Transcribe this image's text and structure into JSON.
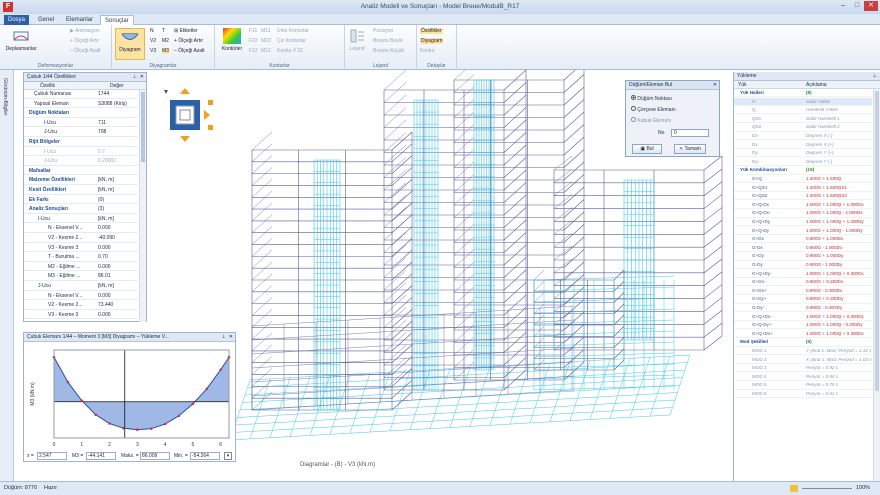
{
  "window": {
    "title": "Analiz Modeli ve Sonuçları - Model Breue/ModulB_R17",
    "app_icon": "F"
  },
  "tabs": [
    {
      "label": "Dosya"
    },
    {
      "label": "Genel"
    },
    {
      "label": "Elemanlar"
    },
    {
      "label": "Sonuçlar"
    }
  ],
  "ribbon": {
    "groups": [
      "Deformasyonlar",
      "Diyagramlar",
      "Konturlar",
      "Lejand",
      "Detaylar"
    ],
    "deform": {
      "big": "Deplasmanlar",
      "animate": "Animasyon",
      "inc": "Ölçeği Artır",
      "dec": "Ölçeği Azalt"
    },
    "diag": {
      "big": "Diyagram",
      "labels": "Etiketler",
      "inc": "Ölçeği Artır",
      "dec": "Ölçeği Azalt",
      "n": "N",
      "t": "T",
      "v2": "V2",
      "v3": "V3",
      "m2": "M2",
      "m3": "M3"
    },
    "contour": {
      "big": "Kontürler",
      "f11": "F11",
      "f22": "F22",
      "f12": "F12",
      "m11": "M11",
      "m22": "M22",
      "m12": "M12",
      "stress": "Ünlü Konturlar",
      "dual": "Çiz Konturlar",
      "contours": "Kontur #",
      "count": "32"
    },
    "legend": {
      "big": "Lejand",
      "pos": "Pozisyon",
      "inc": "Boyutu Büyüt",
      "dec": "Boyutu Küçült"
    },
    "detail": {
      "props": "Özellikler",
      "diagram": "Diyagram",
      "contour": "Kontur"
    }
  },
  "left_strip": "Görünüm-Bilgiler",
  "element_panel": {
    "title": "Çubuk 1/44 Özellikleri",
    "col_prop": "Özellik",
    "col_val": "Değer",
    "rows": [
      {
        "k": "Çubuk Numarası",
        "v": "1744",
        "t": "item"
      },
      {
        "k": "Yapısal Eleman",
        "v": "S3088 (Kiriş)",
        "t": "item"
      },
      {
        "k": "Düğüm Noktaları",
        "v": "",
        "t": "sec"
      },
      {
        "k": "I-Ucu",
        "v": "711",
        "t": "sub"
      },
      {
        "k": "J-Ucu",
        "v": "708",
        "t": "sub"
      },
      {
        "k": "Rijit Bölgeler",
        "v": "",
        "t": "sec"
      },
      {
        "k": "I-Ucu",
        "v": "0.7",
        "t": "gray"
      },
      {
        "k": "J-Ucu",
        "v": "0.20002",
        "t": "gray"
      },
      {
        "k": "Mafsallar",
        "v": "",
        "t": "sec"
      },
      {
        "k": "Malzeme Özellikleri",
        "v": "[kN, m]",
        "t": "sec"
      },
      {
        "k": "Kesit Özellikleri",
        "v": "[kN, m]",
        "t": "sec"
      },
      {
        "k": "Ek Farkı",
        "v": "(0)",
        "t": "sec"
      },
      {
        "k": "Analiz Sonuçları",
        "v": "(3)",
        "t": "sec"
      },
      {
        "k": "I-Ucu",
        "v": "[kN, m]",
        "t": "sub2"
      },
      {
        "k": "N - Eksenel V...",
        "v": "0.000",
        "t": "sub3"
      },
      {
        "k": "V2 - Kesme 2...",
        "v": "-40.090",
        "t": "sub3"
      },
      {
        "k": "V3 - Kesme 3",
        "v": "0.000",
        "t": "sub3"
      },
      {
        "k": "T - Burulma ...",
        "v": "0.70",
        "t": "sub3"
      },
      {
        "k": "M2 - Eğilme ...",
        "v": "0.000",
        "t": "sub3"
      },
      {
        "k": "M3 - Eğilme ...",
        "v": "86.01",
        "t": "sub3"
      },
      {
        "k": "J-Ucu",
        "v": "[kN, m]",
        "t": "sub2"
      },
      {
        "k": "N - Eksenel V...",
        "v": "0.000",
        "t": "sub3"
      },
      {
        "k": "V2 - Kesme 2...",
        "v": "73.440",
        "t": "sub3"
      },
      {
        "k": "V3 - Kesme 3",
        "v": "0.000",
        "t": "sub3"
      }
    ]
  },
  "graph_panel": {
    "title": "Çubuk Elemanı 1/44 – Moment 3 [M3] Diyagramı – Yükleme V...",
    "ylabel": "M3 (kN.m)",
    "x_label": "x =",
    "x_val": "2.547",
    "m3_label": "M3 =",
    "m3_val": "-44.141",
    "max_label": "Maks. =",
    "max_val": "86.009",
    "min_label": "Min. =",
    "min_val": "-54.264",
    "ticks": [
      "0",
      "1",
      "2",
      "3",
      "4",
      "5",
      "6"
    ],
    "curve": [
      [
        0,
        86
      ],
      [
        0.5,
        38
      ],
      [
        1,
        2
      ],
      [
        1.5,
        -25
      ],
      [
        2,
        -42
      ],
      [
        2.5,
        -51
      ],
      [
        3,
        -54
      ],
      [
        3.5,
        -52
      ],
      [
        4,
        -43
      ],
      [
        4.5,
        -27
      ],
      [
        5,
        -4
      ],
      [
        5.5,
        25
      ],
      [
        6,
        62
      ],
      [
        6.3,
        86
      ]
    ]
  },
  "find_panel": {
    "title": "Düğüm/Eleman Bul",
    "opt1": "Düğüm Noktası",
    "opt2": "Çerçeve Elemanı",
    "opt3": "Kabuk Elemanı",
    "no_label": "No",
    "no_val": "0",
    "find": "Bul",
    "cancel": "Tamam"
  },
  "viewport": {
    "caption": "Diagramlar - (B) - V3 (kN.m)"
  },
  "loads_panel": {
    "title": "Yükleme",
    "col_load": "Yük",
    "col_desc": "Açıklama",
    "rows": [
      {
        "a": "Yük Halleri",
        "b": "(8)",
        "t": "sec"
      },
      {
        "a": "G",
        "b": "Sabit Yükler",
        "t": "case sel"
      },
      {
        "a": "Q",
        "b": "Hareketli Yükler",
        "t": "case"
      },
      {
        "a": "QS1",
        "b": "Sabit Hareketli 1",
        "t": "case"
      },
      {
        "a": "QS2",
        "b": "Sabit Hareketli 2",
        "t": "case"
      },
      {
        "a": "Dx-",
        "b": "Deprem X (-)",
        "t": "case"
      },
      {
        "a": "Dx",
        "b": "Deprem X (+)",
        "t": "case"
      },
      {
        "a": "Dy",
        "b": "Deprem Y (+)",
        "t": "case"
      },
      {
        "a": "Dy-",
        "b": "Deprem Y (-)",
        "t": "case"
      },
      {
        "a": "Yük Kombinasyonları",
        "b": "(19)",
        "t": "sec"
      },
      {
        "a": "G+Q",
        "b": "1.400G + 1.600Q",
        "t": "combo"
      },
      {
        "a": "G+QS1",
        "b": "1.400G + 1.600QS1",
        "t": "combo"
      },
      {
        "a": "G+QS2",
        "b": "1.400G + 1.600QS2",
        "t": "combo"
      },
      {
        "a": "G+Q-Dx",
        "b": "1.000G + 1.000Q + 1.000Dx",
        "t": "combo"
      },
      {
        "a": "G+Q-Dx-",
        "b": "1.000G + 1.000Q - 1.000Dx",
        "t": "combo"
      },
      {
        "a": "G+Q+Dy",
        "b": "1.000G + 1.000Q + 1.000Dy",
        "t": "combo"
      },
      {
        "a": "G+Q-Dy",
        "b": "1.000G + 1.000Q - 1.000Dy",
        "t": "combo"
      },
      {
        "a": "G+Dx",
        "b": "0.900G + 1.000Dx",
        "t": "combo"
      },
      {
        "a": "G-Dx",
        "b": "0.900G - 1.000Dx",
        "t": "combo"
      },
      {
        "a": "G+Dy",
        "b": "0.900G + 1.000Dy",
        "t": "combo"
      },
      {
        "a": "G-Dy",
        "b": "0.900G - 1.000Dy",
        "t": "combo"
      },
      {
        "a": "G+Q+Dy-",
        "b": "1.000G + 1.000Q + 0.300Dx",
        "t": "combo"
      },
      {
        "a": "G+Dx-",
        "b": "0.900G + 0.300Dx",
        "t": "combo"
      },
      {
        "a": "G+Dx+",
        "b": "0.900G - 0.300Dx",
        "t": "combo"
      },
      {
        "a": "G+Dy+",
        "b": "0.900G + 0.300Dy",
        "t": "combo"
      },
      {
        "a": "G-Dy-",
        "b": "0.900G - 0.300Dy",
        "t": "combo"
      },
      {
        "a": "G+Q+Dx-",
        "b": "1.000G + 1.000Q + 0.300Dy",
        "t": "combo"
      },
      {
        "a": "G+Q-Dy+",
        "b": "1.000G + 1.000Q - 0.300Dy",
        "t": "combo"
      },
      {
        "a": "G+Q+Dx+",
        "b": "1.000G + 1.000Q + 0.300Dx",
        "t": "combo"
      },
      {
        "a": "Mod Şekilleri",
        "b": "(6)",
        "t": "sec"
      },
      {
        "a": "MOD 1",
        "b": "Y yönü 1. Mod, Periyod = 1.12 s",
        "t": "case"
      },
      {
        "a": "MOD 2",
        "b": "X yönü 1. Mod, Periyod = 1.03 s",
        "t": "case"
      },
      {
        "a": "MOD 3",
        "b": "Periyot = 0.92 s",
        "t": "case"
      },
      {
        "a": "MOD 4",
        "b": "Periyot = 0.84 s",
        "t": "case"
      },
      {
        "a": "MOD 5",
        "b": "Periyot = 0.75 s",
        "t": "case"
      },
      {
        "a": "MOD 6",
        "b": "Periyot = 0.61 s",
        "t": "case"
      }
    ]
  },
  "status": {
    "left": "Düğüm: 8770",
    "right": "Hazır",
    "zoom": "100%"
  },
  "colors": {
    "accent": "#2b5fa8",
    "mesh": "#3fc9e8",
    "frame": "#5a5a9a",
    "orange": "#f0a020"
  }
}
